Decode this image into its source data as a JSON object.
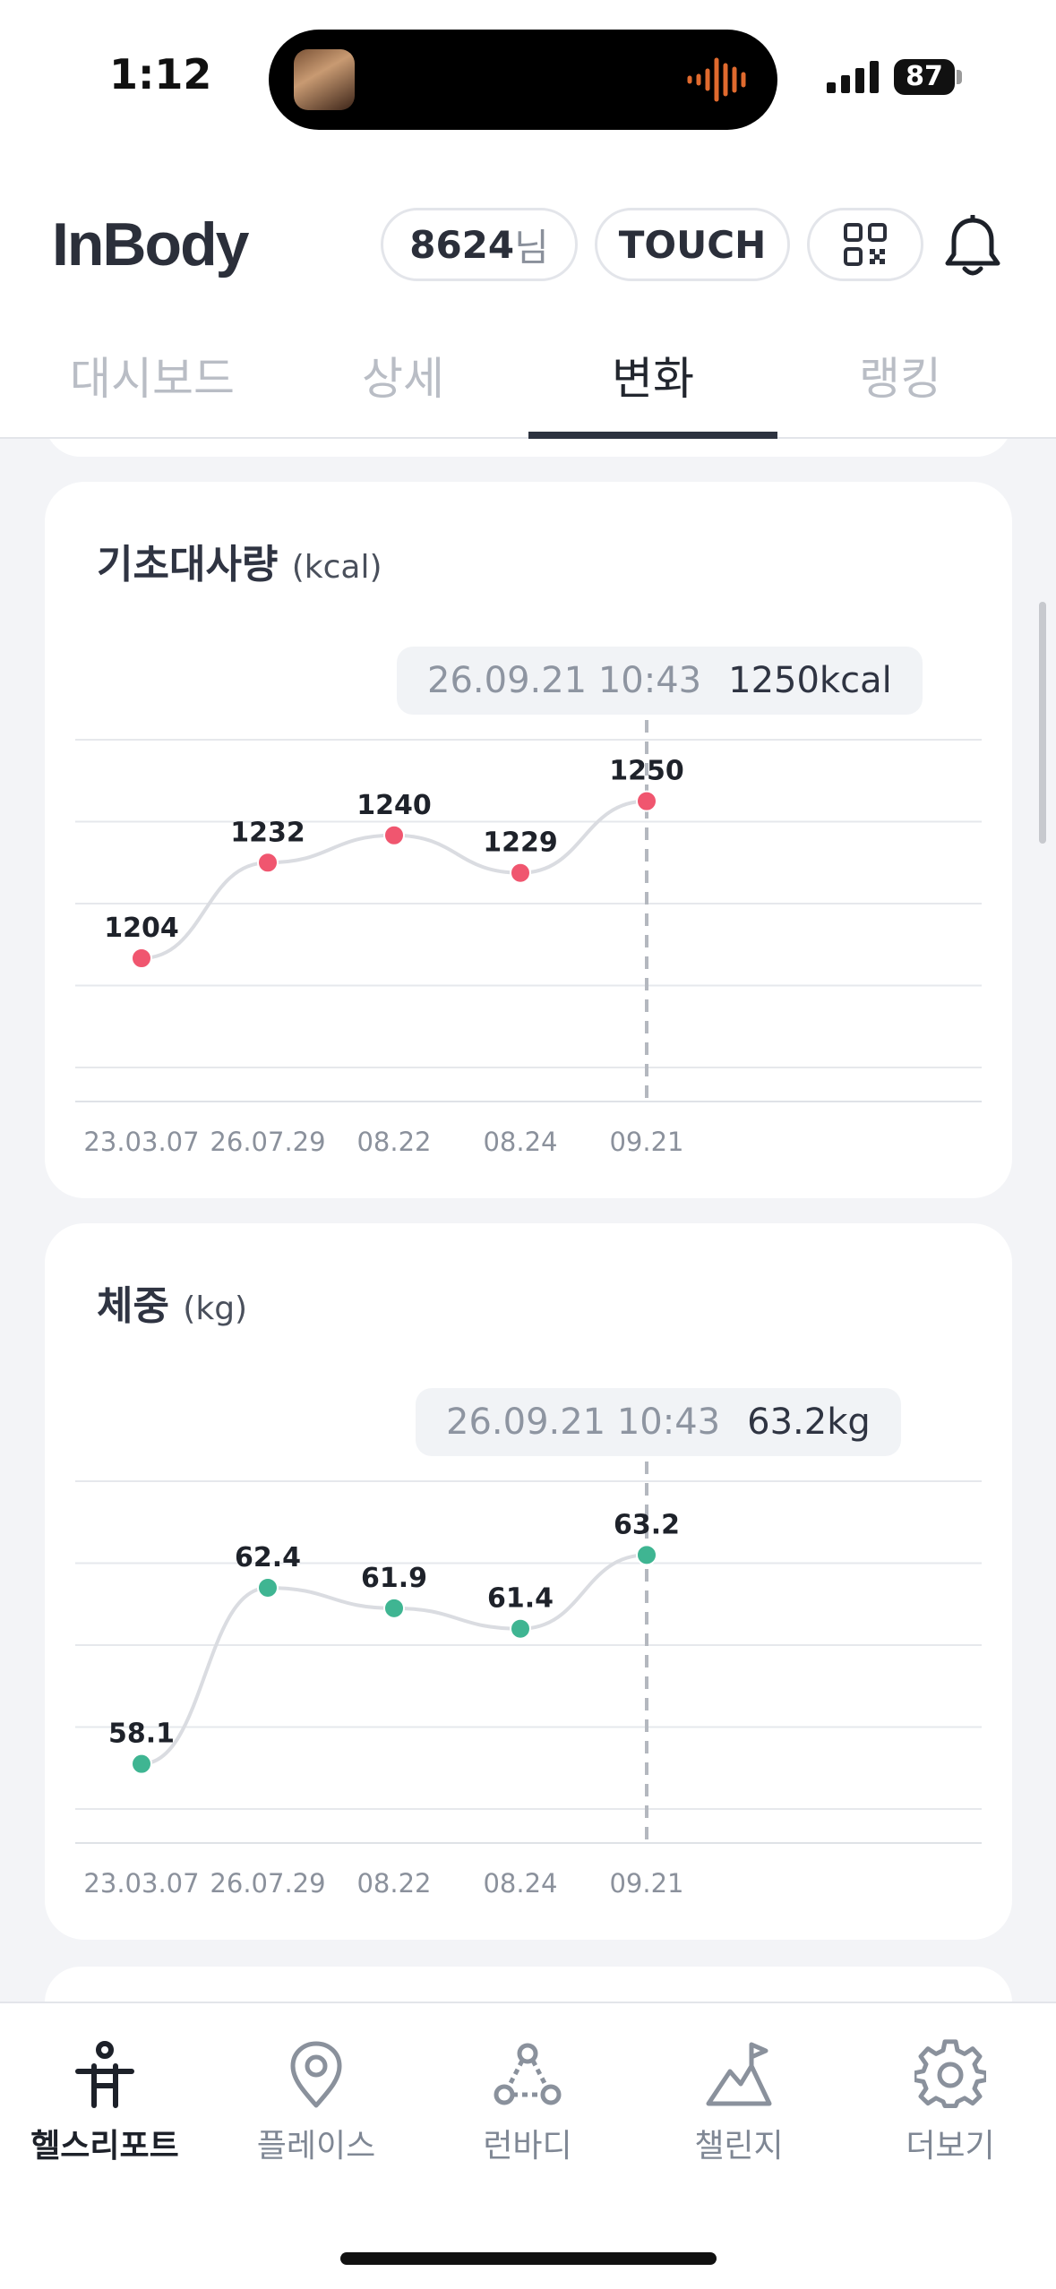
{
  "status_bar": {
    "time": "1:12",
    "battery": "87"
  },
  "header": {
    "logo": "InBody",
    "user_id": "8624",
    "user_suffix": "님",
    "touch_label": "TOUCH"
  },
  "tabs": [
    {
      "label": "대시보드",
      "active": false
    },
    {
      "label": "상세",
      "active": false
    },
    {
      "label": "변화",
      "active": true
    },
    {
      "label": "랭킹",
      "active": false
    }
  ],
  "charts": {
    "bmr": {
      "title": "기초대사량",
      "unit": "(kcal)",
      "tooltip_date": "26.09.21 10:43",
      "tooltip_value": "1250kcal"
    },
    "weight": {
      "title": "체중",
      "unit": "(kg)",
      "tooltip_date": "26.09.21 10:43",
      "tooltip_value": "63.2kg"
    }
  },
  "chart_data": [
    {
      "type": "line",
      "title": "기초대사량",
      "ylabel": "(kcal)",
      "categories": [
        "23.03.07",
        "26.07.29",
        "08.22",
        "08.24",
        "09.21"
      ],
      "values": [
        1204,
        1232,
        1240,
        1229,
        1250
      ],
      "ylim": [
        1172,
        1268
      ],
      "grid": true,
      "selected_index": 4,
      "color": "#f0566f"
    },
    {
      "type": "line",
      "title": "체중",
      "ylabel": "(kg)",
      "categories": [
        "23.03.07",
        "26.07.29",
        "08.22",
        "08.24",
        "09.21"
      ],
      "values": [
        58.1,
        62.4,
        61.9,
        61.4,
        63.2
      ],
      "ylim": [
        57.0,
        65.0
      ],
      "grid": true,
      "selected_index": 4,
      "color": "#3fb592"
    }
  ],
  "bottom_nav": [
    {
      "label": "헬스리포트",
      "icon": "health-report-icon",
      "active": true
    },
    {
      "label": "플레이스",
      "icon": "location-pin-icon",
      "active": false
    },
    {
      "label": "런바디",
      "icon": "runbody-icon",
      "active": false
    },
    {
      "label": "챌린지",
      "icon": "challenge-flag-icon",
      "active": false
    },
    {
      "label": "더보기",
      "icon": "gear-icon",
      "active": false
    }
  ]
}
